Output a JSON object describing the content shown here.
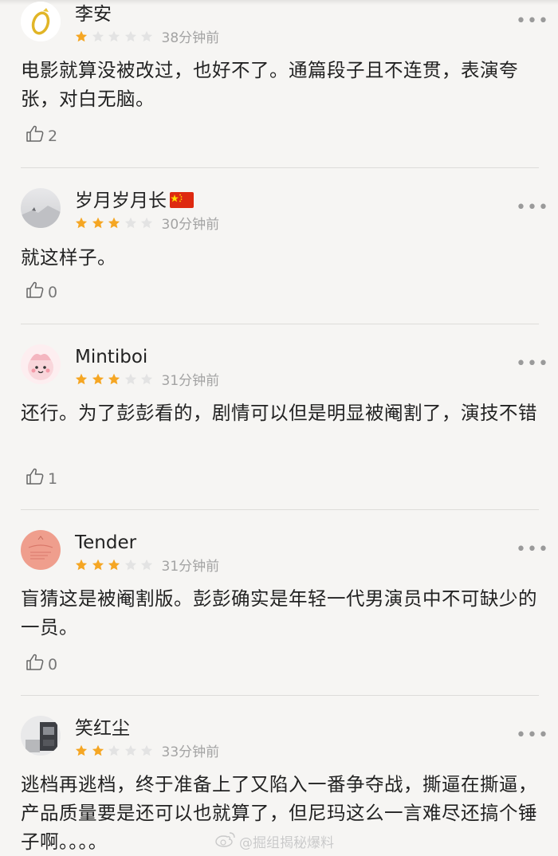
{
  "reviews": [
    {
      "username": "李安",
      "stars": 1,
      "time": "38分钟前",
      "content": "电影就算没被改过，也好不了。通篇段子且不连贯，表演夸张，对白无脑。",
      "likes": "2",
      "avatar_icon": "gold-ring-icon"
    },
    {
      "username": "岁月岁月长",
      "stars": 3,
      "time": "30分钟前",
      "content": "就这样子。",
      "likes": "0",
      "avatar_icon": "landscape-photo-icon",
      "badge_icon": "china-flag-icon"
    },
    {
      "username": "Mintiboi",
      "stars": 3,
      "time": "31分钟前",
      "content": "还行。为了彭彭看的，剧情可以但是明显被阉割了，演技不错",
      "likes": "1",
      "avatar_icon": "pink-cartoon-icon"
    },
    {
      "username": "Tender",
      "stars": 3,
      "time": "31分钟前",
      "content": "盲猜这是被阉割版。彭彭确实是年轻一代男演员中不可缺少的一员。",
      "likes": "0",
      "avatar_icon": "coral-postcard-icon"
    },
    {
      "username": "笑红尘",
      "stars": 2,
      "time": "33分钟前",
      "content": "逃档再逃档，终于准备上了又陷入一番争夺战，撕逼在撕逼，产品质量要是还可以也就算了，但尼玛这么一言难尽还搞个锤子啊。。。。",
      "likes": "",
      "avatar_icon": "dark-room-photo-icon"
    }
  ],
  "more_label": "•••",
  "watermark": "@掘组揭秘爆料",
  "colors": {
    "star_filled": "#f5a623",
    "star_empty": "#e3e3e3",
    "text": "#222222",
    "meta": "#a3a3a3",
    "background": "#f6f5f3"
  }
}
